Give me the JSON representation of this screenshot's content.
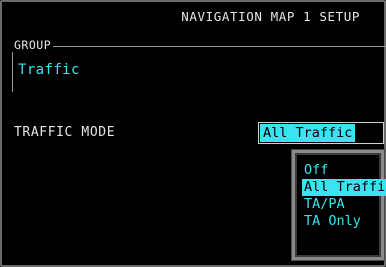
{
  "screen": {
    "title": "NAVIGATION MAP 1 SETUP"
  },
  "group": {
    "legend": "GROUP",
    "value": "Traffic"
  },
  "traffic_mode": {
    "label": "TRAFFIC MODE",
    "selected": "All Traffic",
    "options": [
      "Off",
      "All Traffic",
      "TA/PA",
      "TA Only"
    ],
    "highlighted_option": "All Traffic"
  },
  "colors": {
    "accent_cyan": "#39e3f0",
    "text_white": "#e6e6e6",
    "background": "#000000",
    "frame_gray": "#8a8a8a"
  }
}
